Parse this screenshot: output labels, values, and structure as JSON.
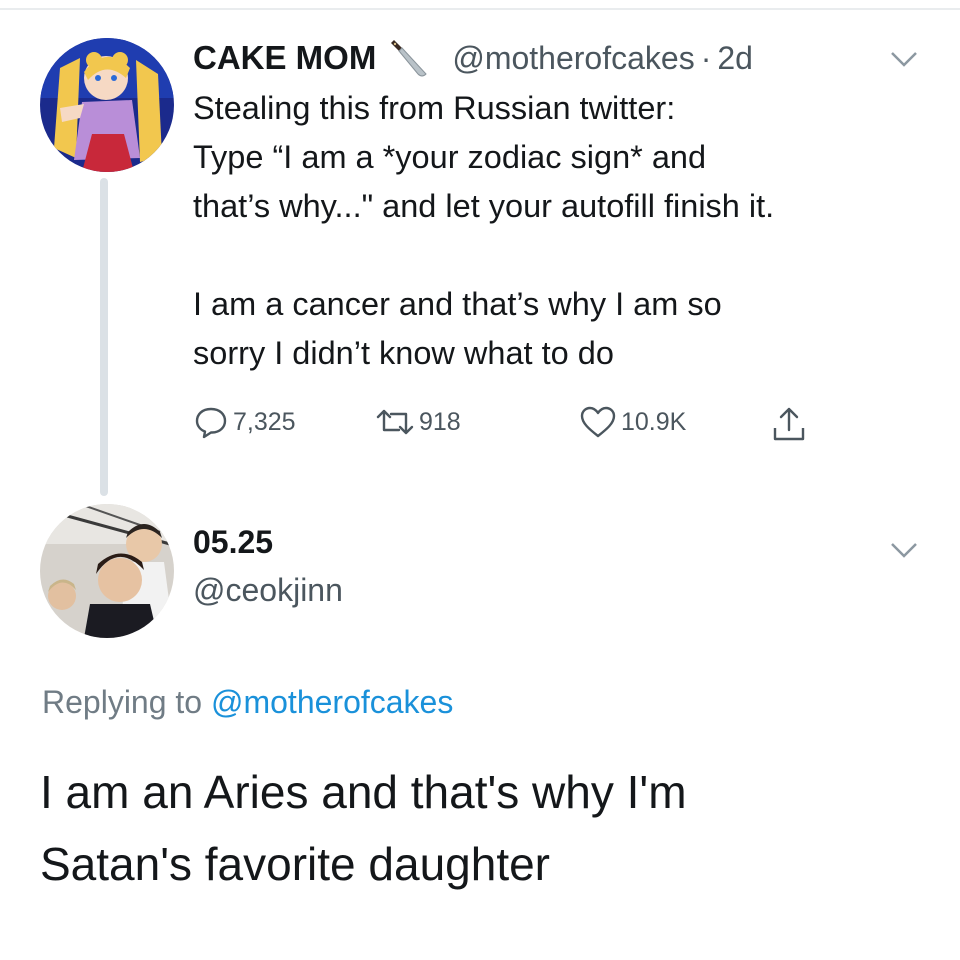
{
  "tweet": {
    "author": {
      "name": "CAKE MOM",
      "name_emoji_icon": "knife-icon",
      "handle": "@motherofcakes",
      "separator": "·",
      "time": "2d"
    },
    "body": {
      "line1": "Stealing this from Russian twitter:",
      "line2": "Type “I am a *your zodiac sign* and",
      "line3": "that’s why...\" and let your autofill finish it.",
      "line4": "I am a cancer and that’s why I am so",
      "line5": "sorry I didn’t know what to do"
    },
    "actions": {
      "replies": "7,325",
      "retweets": "918",
      "likes": "10.9K",
      "icons": [
        "reply-icon",
        "retweet-icon",
        "like-icon",
        "share-icon"
      ]
    }
  },
  "reply": {
    "author": {
      "name": "05.25",
      "handle": "@ceokjinn"
    },
    "replying_prefix": "Replying to",
    "replying_to": "@motherofcakes",
    "body": {
      "line1": "I am an Aries and that's why I'm",
      "line2": "Satan's favorite daughter"
    }
  },
  "colors": {
    "text": "#14171a",
    "secondary": "#4b565e",
    "link": "#1a91da",
    "thread_line": "#dbe1e6"
  }
}
